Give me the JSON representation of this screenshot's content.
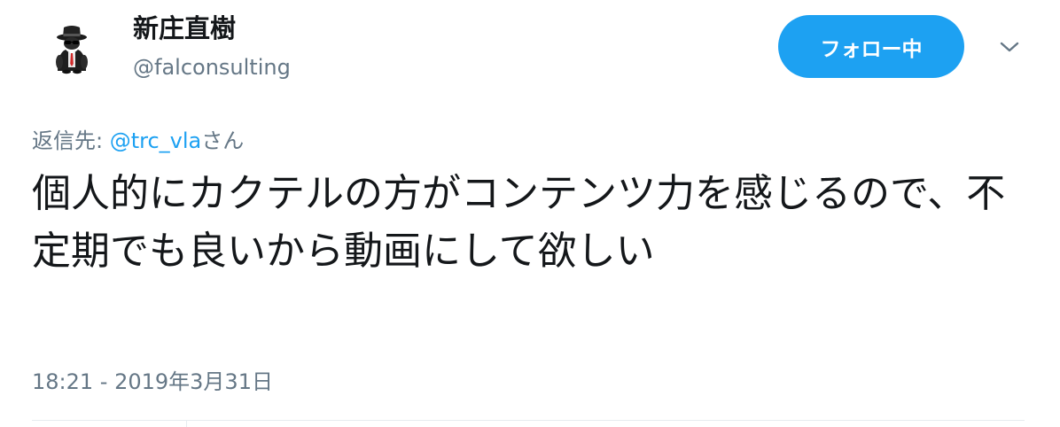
{
  "author": {
    "display_name": "新庄直樹",
    "screen_name": "@falconsulting",
    "avatar_icon": "spy-character-avatar-icon"
  },
  "header": {
    "follow_button_label": "フォロー中",
    "menu_icon": "chevron-down-icon"
  },
  "reply_context": {
    "prefix": "返信先: ",
    "mention": "@trc_vla",
    "suffix": "さん"
  },
  "tweet": {
    "text": "個人的にカクテルの方がコンテンツ力を感じるので、不定期でも良いから動画にして欲しい",
    "timestamp": "18:21 - 2019年3月31日"
  },
  "colors": {
    "accent": "#1da1f2",
    "text_primary": "#14171a",
    "text_secondary": "#657786",
    "divider": "#e6ecf0"
  }
}
